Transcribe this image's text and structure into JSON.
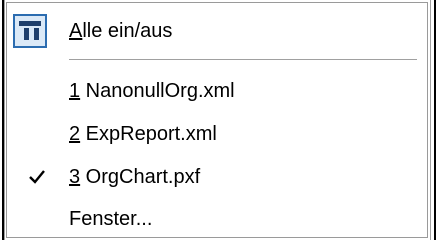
{
  "menu": {
    "toggle_all": {
      "prefix": "",
      "mnemonic": "A",
      "rest": "lle ein/aus",
      "icon": "tile-windows-icon"
    },
    "recent": [
      {
        "mnemonic": "1",
        "rest": " NanonullOrg.xml",
        "checked": false
      },
      {
        "mnemonic": "2",
        "rest": " ExpReport.xml",
        "checked": false
      },
      {
        "mnemonic": "3",
        "rest": " OrgChart.pxf",
        "checked": true
      }
    ],
    "windows": {
      "label": "Fenster..."
    }
  },
  "colors": {
    "icon_border": "#2b6cb0",
    "icon_fill": "#dbe9f7",
    "icon_dark": "#1f3f6b"
  }
}
